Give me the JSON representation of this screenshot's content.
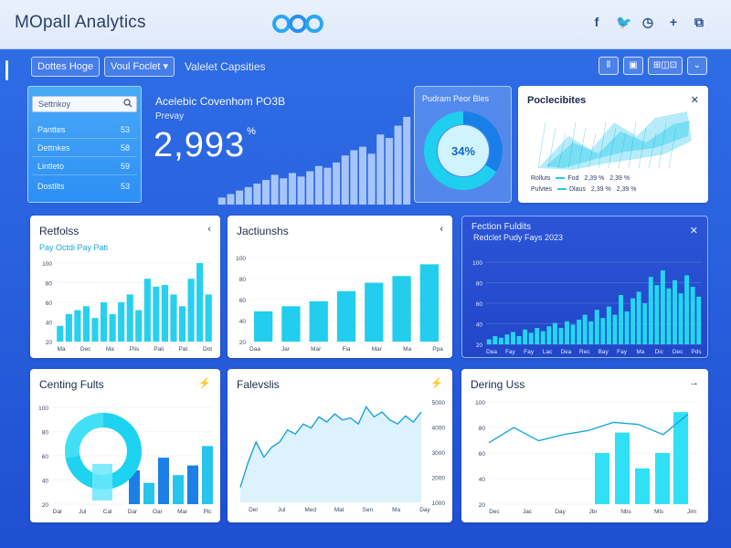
{
  "app": {
    "title": "MOpall Analytics",
    "social_icons": [
      "facebook-icon",
      "twitter-icon",
      "clock-icon",
      "plus-icon",
      "grid-icon"
    ],
    "social_glyphs": [
      "f",
      "🐦",
      "◷",
      "+",
      "⧉"
    ]
  },
  "toolbar": {
    "btn1": "Dottes Hoge",
    "btn2": "Voul Foclet",
    "btn2_caret": "▾",
    "text": "Valelet Capsities",
    "right_icons": [
      "lock-icon",
      "export-icon"
    ],
    "right_icon_glyphs": [
      "⦀",
      "▣"
    ],
    "right_label": "⊞◫⊡",
    "dropdown_caret": "⌄"
  },
  "search_panel": {
    "placeholder": "Settnkoy",
    "rows": [
      {
        "label": "Panttes",
        "value": "53"
      },
      {
        "label": "Dettnkes",
        "value": "58"
      },
      {
        "label": "Lintleto",
        "value": "59"
      },
      {
        "label": "Dostllts",
        "value": "53"
      }
    ]
  },
  "kpi": {
    "title": "Acelebic Covenhom PO3B",
    "subtitle": "Prevay",
    "value": "2,993",
    "sup": "%",
    "bars": [
      0.08,
      0.12,
      0.16,
      0.2,
      0.24,
      0.28,
      0.34,
      0.3,
      0.36,
      0.32,
      0.38,
      0.44,
      0.42,
      0.48,
      0.56,
      0.62,
      0.66,
      0.58,
      0.8,
      0.76,
      0.9,
      1.0
    ]
  },
  "donut": {
    "title": "Pudram Peor Bles",
    "value": "34%",
    "percent": 34
  },
  "card_top_right": {
    "title": "Poclecibites",
    "close": "✕",
    "legend": [
      {
        "a": "Rolluts",
        "b": "Fod",
        "c": "2,39 %"
      },
      {
        "a": "Pulvtes",
        "b": "Dlaus",
        "c": "2,39 %"
      }
    ],
    "colors": [
      "#28c8ea",
      "#0e9ed8"
    ]
  },
  "card_retfolss": {
    "title": "Retfolss",
    "subtitle": "Pay Octdi Pay Pati",
    "ctl": "‹",
    "y_ticks": [
      "100",
      "80",
      "60",
      "40",
      "20"
    ],
    "x_ticks": [
      "Ma",
      "Dec",
      "Ma",
      "Plis",
      "Pali",
      "Pat",
      "Dot"
    ],
    "values": [
      0.2,
      0.35,
      0.4,
      0.45,
      0.3,
      0.5,
      0.35,
      0.5,
      0.6,
      0.4,
      0.8,
      0.7,
      0.72,
      0.6,
      0.45,
      0.8,
      1.0,
      0.6
    ]
  },
  "card_jactiunshs": {
    "title": "Jactiunshs",
    "ctl": "‹",
    "y_ticks": [
      "100",
      "80",
      "60",
      "40",
      "20"
    ],
    "x_ticks": [
      "Daa",
      "Jar",
      "Mar",
      "Fia",
      "Mar",
      "Ma",
      "Ppa"
    ],
    "values": [
      0.36,
      0.42,
      0.48,
      0.6,
      0.7,
      0.78,
      0.92
    ]
  },
  "card_dark": {
    "title": "Fection Fuldits",
    "subtitle": "Redclet Pudy Fays 2023",
    "ctl": "✕",
    "y_ticks": [
      "100",
      "80",
      "60",
      "40",
      "20"
    ],
    "x_ticks": [
      "Dea",
      "Fay",
      "Fay",
      "Lac",
      "Dea",
      "Rec",
      "Bay",
      "Fay",
      "Ma",
      "Dic",
      "Dec",
      "Pds"
    ],
    "values": [
      0.06,
      0.1,
      0.08,
      0.12,
      0.15,
      0.1,
      0.18,
      0.14,
      0.2,
      0.16,
      0.22,
      0.26,
      0.2,
      0.28,
      0.24,
      0.3,
      0.36,
      0.28,
      0.42,
      0.32,
      0.46,
      0.36,
      0.6,
      0.4,
      0.56,
      0.64,
      0.5,
      0.82,
      0.72,
      0.9,
      0.68,
      0.78,
      0.62,
      0.84,
      0.7,
      0.58
    ]
  },
  "card_centing": {
    "title": "Centing Fults",
    "ctl": "⚡",
    "y_ticks": [
      "100",
      "80",
      "60",
      "40",
      "20"
    ],
    "x_ticks": [
      "Dar",
      "Jul",
      "Cal",
      "Dar",
      "Oar",
      "Mar",
      "Plc"
    ],
    "bars": [
      0.35,
      0.22,
      0.48,
      0.3,
      0.4,
      0.6
    ],
    "ring_percent": 72
  },
  "card_falevslis": {
    "title": "Falevslis",
    "ctl": "⚡",
    "y_ticks": [
      "5000",
      "4000",
      "3000",
      "2000",
      "1000"
    ],
    "x_ticks": [
      "Del",
      "Jul",
      "Med",
      "Mal",
      "Sen",
      "Ma",
      "Day"
    ],
    "values": [
      0.15,
      0.4,
      0.6,
      0.45,
      0.55,
      0.6,
      0.72,
      0.68,
      0.78,
      0.74,
      0.85,
      0.8,
      0.88,
      0.82,
      0.84,
      0.78,
      0.95,
      0.85,
      0.9,
      0.82,
      0.78,
      0.86,
      0.8,
      0.9
    ]
  },
  "card_dering": {
    "title": "Dering Uss",
    "ctl": "→",
    "y_ticks": [
      "100",
      "80",
      "60",
      "40",
      "20"
    ],
    "x_ticks": [
      "Dec",
      "Jac",
      "Day",
      "Jbr",
      "Nbs",
      "Mls",
      "Jim"
    ],
    "bars": [
      0.5,
      0.7,
      0.35,
      0.5,
      0.9
    ],
    "line": [
      0.6,
      0.75,
      0.62,
      0.68,
      0.72,
      0.8,
      0.78,
      0.68,
      0.88
    ]
  }
}
